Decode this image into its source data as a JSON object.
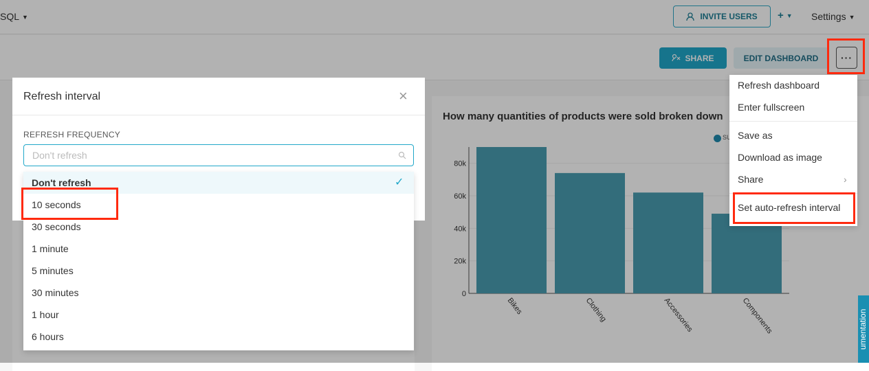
{
  "topnav": {
    "sql_label": "SQL",
    "invite_label": "INVITE USERS",
    "plus_label": "+",
    "settings_label": "Settings"
  },
  "dashboard": {
    "share_label": "SHARE",
    "edit_label": "EDIT DASHBOARD",
    "more_label": "···"
  },
  "chart": {
    "title": "How many quantities of products were sold broken down",
    "legend_label": "SU",
    "accent": "#4a9db0"
  },
  "chart_data": {
    "type": "bar",
    "title": "How many quantities of products were sold broken down",
    "categories": [
      "Bikes",
      "Clothing",
      "Accessories",
      "Components"
    ],
    "values": [
      90000,
      74000,
      62000,
      49000
    ],
    "yticks": [
      "0",
      "20k",
      "40k",
      "60k",
      "80k"
    ],
    "ylim": [
      0,
      90000
    ],
    "xlabel": "",
    "ylabel": "",
    "grid": true
  },
  "more_menu": {
    "items": [
      {
        "label": "Refresh dashboard"
      },
      {
        "label": "Enter fullscreen"
      },
      {
        "label": "Save as"
      },
      {
        "label": "Download as image"
      },
      {
        "label": "Share",
        "chevron": "›"
      },
      {
        "label": "Set auto-refresh interval"
      }
    ]
  },
  "modal": {
    "title": "Refresh interval",
    "close": "×",
    "field_label": "REFRESH FREQUENCY",
    "placeholder": "Don't refresh"
  },
  "options": {
    "check": "✓",
    "items": [
      {
        "label": "Don't refresh",
        "selected": true
      },
      {
        "label": "10 seconds"
      },
      {
        "label": "30 seconds"
      },
      {
        "label": "1 minute"
      },
      {
        "label": "5 minutes"
      },
      {
        "label": "30 minutes"
      },
      {
        "label": "1 hour"
      },
      {
        "label": "6 hours"
      }
    ]
  },
  "side_tab": {
    "label": "umentation"
  },
  "colors": {
    "highlight": "#ff2a0e",
    "primary": "#20a7c9"
  }
}
